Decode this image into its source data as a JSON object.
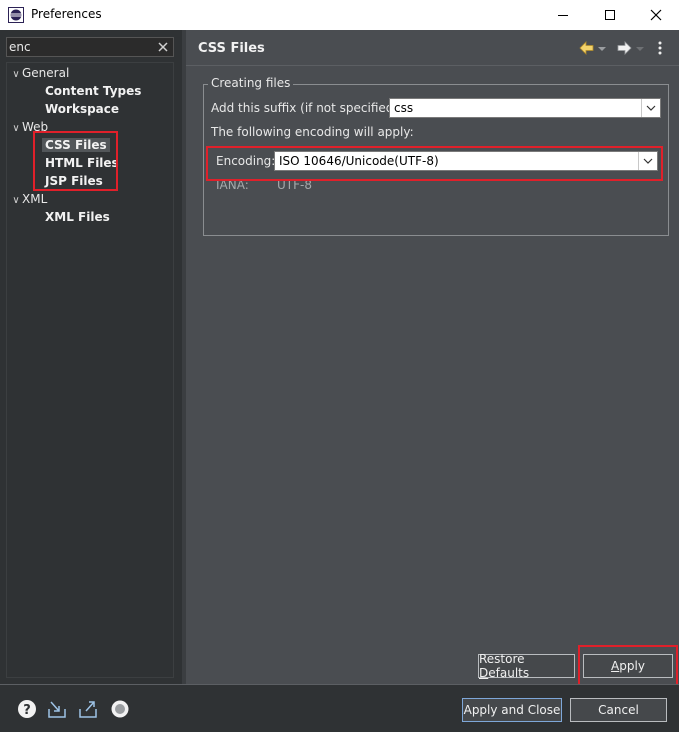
{
  "window": {
    "title": "Preferences",
    "icon": "eclipse-icon"
  },
  "search": {
    "value": "enc"
  },
  "tree": {
    "general": {
      "label": "General",
      "children": [
        "Content Types",
        "Workspace"
      ]
    },
    "web": {
      "label": "Web",
      "children": [
        "CSS Files",
        "HTML Files",
        "JSP Files"
      ],
      "selected": "CSS Files"
    },
    "xml": {
      "label": "XML",
      "children": [
        "XML Files"
      ]
    }
  },
  "page": {
    "title": "CSS Files",
    "group_title": "Creating files",
    "suffix_label": "Add this suffix (if not specified):",
    "suffix_value": "css",
    "encoding_note": "The following encoding will apply:",
    "encoding_label": "Encoding:",
    "encoding_value": "ISO 10646/Unicode(UTF-8)",
    "iana_label": "IANA:",
    "iana_value": "UTF-8"
  },
  "buttons": {
    "restore_defaults_pre": "Restore ",
    "restore_defaults_mn": "D",
    "restore_defaults_post": "efaults",
    "apply_mn": "A",
    "apply_post": "pply",
    "apply_and_close": "Apply and Close",
    "cancel": "Cancel"
  },
  "colors": {
    "highlight": "#e0202a",
    "background": "#4a4d51",
    "tree_background": "#2f3234"
  },
  "icons": {
    "back": "arrow-left-icon",
    "forward": "arrow-right-icon",
    "menu": "vertical-ellipsis-icon",
    "help": "help-icon",
    "import": "import-icon",
    "export": "export-icon",
    "record": "record-icon"
  }
}
